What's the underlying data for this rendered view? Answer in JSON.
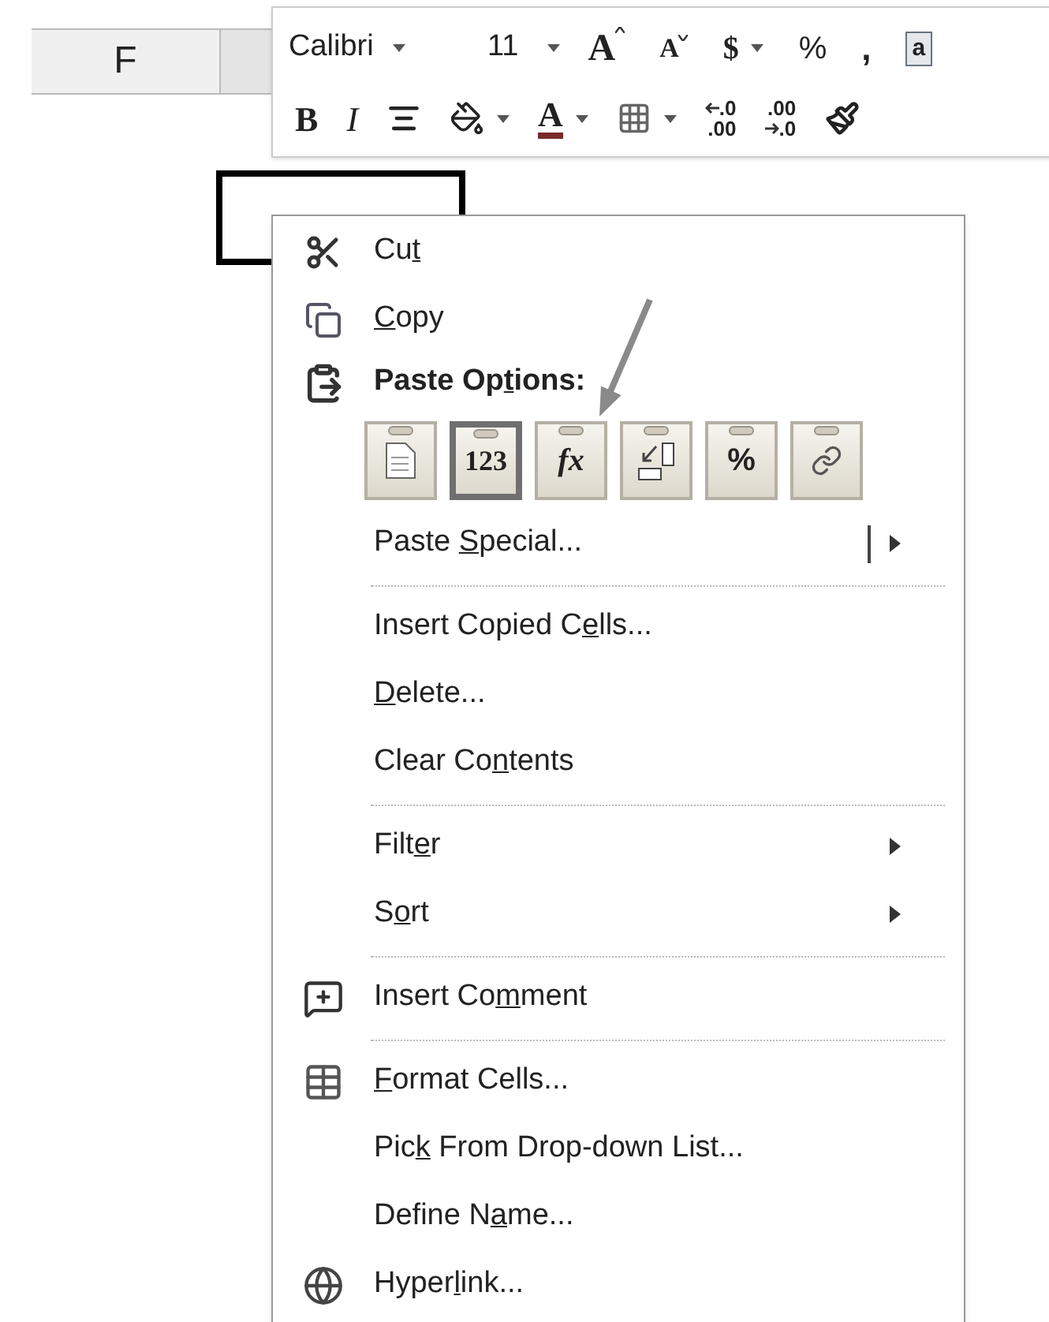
{
  "sheet": {
    "column_header": "F"
  },
  "mini_toolbar": {
    "font": "Calibri",
    "size": "11",
    "row1": [
      {
        "kind": "grow",
        "text": "A"
      },
      {
        "kind": "shrink",
        "text": "A"
      },
      {
        "kind": "currency",
        "text": "$",
        "dropdown": true
      },
      {
        "kind": "percent",
        "text": "%"
      },
      {
        "kind": "comma",
        "text": ","
      },
      {
        "kind": "merge",
        "text": "a"
      }
    ],
    "row2": [
      {
        "kind": "bold",
        "text": "B"
      },
      {
        "kind": "italic",
        "text": "I"
      },
      {
        "kind": "center"
      },
      {
        "kind": "fill",
        "dropdown": true
      },
      {
        "kind": "fontcolor",
        "text": "A",
        "dropdown": true
      },
      {
        "kind": "borders",
        "dropdown": true
      },
      {
        "kind": "increase_decimal",
        "top": ".0",
        "bottom": ".00"
      },
      {
        "kind": "decrease_decimal",
        "top": ".00",
        "bottom": ".0"
      },
      {
        "kind": "painter"
      }
    ]
  },
  "context_menu": [
    {
      "kind": "cut",
      "pre": "Cu",
      "key": "t"
    },
    {
      "kind": "copy",
      "key": "C",
      "post": "opy"
    },
    {
      "kind": "paste_header",
      "pre": "Paste Op",
      "key": "t",
      "post": "ions:"
    },
    {
      "kind": "paste_options",
      "options": [
        {
          "kind": "paste",
          "selected": false
        },
        {
          "kind": "values",
          "text": "123",
          "selected": true
        },
        {
          "kind": "formulas",
          "text": "fx",
          "selected": false
        },
        {
          "kind": "transpose",
          "selected": false
        },
        {
          "kind": "formatting",
          "text": "%",
          "selected": false
        },
        {
          "kind": "link",
          "selected": false
        }
      ]
    },
    {
      "kind": "plain",
      "pre": "Paste ",
      "key": "S",
      "post": "pecial...",
      "submenu": true,
      "split": true
    },
    {
      "kind": "separator"
    },
    {
      "kind": "plain",
      "pre": "Insert Copied C",
      "key": "e",
      "post": "lls..."
    },
    {
      "kind": "plain",
      "key": "D",
      "post": "elete..."
    },
    {
      "kind": "plain",
      "pre": "Clear Co",
      "key": "n",
      "post": "tents"
    },
    {
      "kind": "separator"
    },
    {
      "kind": "plain",
      "pre": "Filt",
      "key": "e",
      "post": "r",
      "submenu": true
    },
    {
      "kind": "plain",
      "pre": "S",
      "key": "o",
      "post": "rt",
      "submenu": true
    },
    {
      "kind": "separator"
    },
    {
      "kind": "comment",
      "pre": "Insert Co",
      "key": "m",
      "post": "ment"
    },
    {
      "kind": "separator"
    },
    {
      "kind": "format",
      "key": "F",
      "post": "ormat Cells..."
    },
    {
      "kind": "plain",
      "pre": "Pic",
      "key": "k",
      "post": " From Drop-down List..."
    },
    {
      "kind": "plain",
      "pre": "Define N",
      "key": "a",
      "post": "me..."
    },
    {
      "kind": "hyperlink",
      "pre": "Hyper",
      "key": "l",
      "post": "ink..."
    }
  ]
}
